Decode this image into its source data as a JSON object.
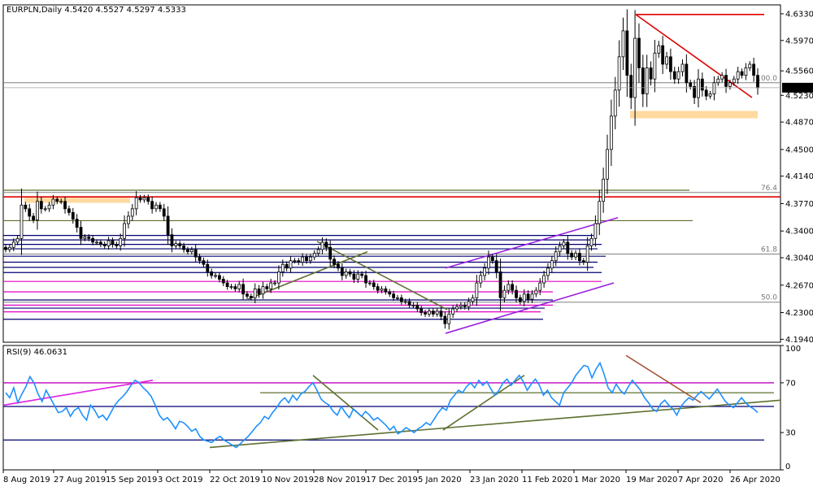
{
  "header": {
    "symbol": "EURPLN,Daily",
    "ohlc": "4.5420 4.5527 4.5297 4.5333"
  },
  "colors": {
    "background": "#ffffff",
    "candle": "#000000",
    "grid": "#808080",
    "red_line": "#e00000",
    "olive_line": "#5e7030",
    "navy_line": "#000070",
    "magenta_line": "#e000c0",
    "purple_line": "#9a20e0",
    "orange_band": "#ffd9a0",
    "rsi_line": "#1e90ff",
    "current_price_bg": "#000000",
    "current_price_fg": "#ffffff"
  },
  "chart_data": [
    {
      "type": "candlestick",
      "title": "EURPLN,Daily",
      "ylim": [
        4.19,
        4.645
      ],
      "y_ticks": [
        "4.6330",
        "4.5970",
        "4.5560",
        "4.5230",
        "4.4870",
        "4.4500",
        "4.4140",
        "4.3770",
        "4.3400",
        "4.3040",
        "4.2670",
        "4.2300",
        "4.1940"
      ],
      "current_price": "4.5333",
      "x_labels": [
        "8 Aug 2019",
        "27 Aug 2019",
        "15 Sep 2019",
        "3 Oct 2019",
        "22 Oct 2019",
        "10 Nov 2019",
        "28 Nov 2019",
        "17 Dec 2019",
        "5 Jan 2020",
        "23 Jan 2020",
        "11 Feb 2020",
        "1 Mar 2020",
        "19 Mar 2020",
        "7 Apr 2020",
        "26 Apr 2020"
      ],
      "fib_levels": [
        {
          "label": "100.0",
          "value": 4.54
        },
        {
          "label": "76.4",
          "value": 4.392
        },
        {
          "label": "61.8",
          "value": 4.309
        },
        {
          "label": "50.0",
          "value": 4.244
        }
      ],
      "closes": [
        4.315,
        4.318,
        4.325,
        4.33,
        4.375,
        4.37,
        4.36,
        4.355,
        4.38,
        4.37,
        4.37,
        4.375,
        4.383,
        4.38,
        4.38,
        4.37,
        4.365,
        4.356,
        4.345,
        4.33,
        4.332,
        4.33,
        4.325,
        4.325,
        4.322,
        4.32,
        4.327,
        4.322,
        4.32,
        4.33,
        4.35,
        4.36,
        4.37,
        4.385,
        4.382,
        4.385,
        4.38,
        4.37,
        4.375,
        4.37,
        4.36,
        4.335,
        4.32,
        4.323,
        4.32,
        4.315,
        4.312,
        4.315,
        4.305,
        4.3,
        4.295,
        4.285,
        4.28,
        4.28,
        4.275,
        4.27,
        4.265,
        4.265,
        4.262,
        4.268,
        4.255,
        4.252,
        4.25,
        4.262,
        4.255,
        4.265,
        4.262,
        4.27,
        4.27,
        4.285,
        4.295,
        4.29,
        4.3,
        4.3,
        4.298,
        4.305,
        4.3,
        4.305,
        4.31,
        4.315,
        4.325,
        4.318,
        4.302,
        4.295,
        4.29,
        4.28,
        4.285,
        4.282,
        4.275,
        4.282,
        4.28,
        4.27,
        4.27,
        4.265,
        4.26,
        4.262,
        4.258,
        4.255,
        4.25,
        4.25,
        4.245,
        4.245,
        4.24,
        4.24,
        4.235,
        4.23,
        4.228,
        4.232,
        4.228,
        4.232,
        4.225,
        4.215,
        4.228,
        4.235,
        4.238,
        4.24,
        4.238,
        4.245,
        4.25,
        4.27,
        4.28,
        4.29,
        4.305,
        4.3,
        4.285,
        4.25,
        4.26,
        4.268,
        4.26,
        4.25,
        4.245,
        4.255,
        4.248,
        4.255,
        4.26,
        4.27,
        4.28,
        4.29,
        4.3,
        4.312,
        4.32,
        4.325,
        4.31,
        4.305,
        4.31,
        4.3,
        4.298,
        4.32,
        4.33,
        4.35,
        4.38,
        4.41,
        4.45,
        4.495,
        4.53,
        4.575,
        4.61,
        4.55,
        4.52,
        4.6,
        4.56,
        4.525,
        4.56,
        4.545,
        4.58,
        4.59,
        4.565,
        4.575,
        4.555,
        4.545,
        4.555,
        4.565,
        4.54,
        4.535,
        4.52,
        4.545,
        4.53,
        4.522,
        4.525,
        4.54,
        4.545,
        4.55,
        4.535,
        4.54,
        4.545,
        4.555,
        4.55,
        4.56,
        4.565,
        4.55,
        4.5333
      ]
    },
    {
      "type": "line",
      "title": "RSI(9) 46.0631",
      "ylim": [
        0,
        100
      ],
      "y_ticks": [
        "100",
        "70",
        "30",
        "0"
      ],
      "levels": [
        70,
        52,
        24
      ],
      "values": [
        62,
        58,
        66,
        54,
        61,
        67,
        75,
        70,
        61,
        55,
        64,
        58,
        52,
        46,
        47,
        50,
        43,
        48,
        50,
        44,
        40,
        52,
        48,
        42,
        44,
        40,
        46,
        52,
        56,
        59,
        63,
        68,
        72,
        70,
        66,
        63,
        59,
        52,
        44,
        40,
        42,
        38,
        33,
        39,
        38,
        35,
        31,
        33,
        27,
        24,
        23,
        22,
        25,
        27,
        24,
        22,
        20,
        18,
        21,
        24,
        27,
        31,
        35,
        38,
        43,
        41,
        46,
        50,
        55,
        58,
        54,
        60,
        56,
        61,
        63,
        67,
        70,
        64,
        57,
        54,
        52,
        47,
        44,
        51,
        46,
        42,
        49,
        46,
        43,
        47,
        44,
        40,
        42,
        39,
        36,
        32,
        35,
        29,
        31,
        34,
        32,
        30,
        33,
        35,
        38,
        36,
        41,
        46,
        50,
        48,
        56,
        60,
        64,
        62,
        67,
        70,
        66,
        72,
        68,
        71,
        65,
        60,
        64,
        70,
        73,
        68,
        72,
        76,
        71,
        64,
        69,
        73,
        68,
        60,
        64,
        58,
        55,
        52,
        62,
        66,
        70,
        76,
        80,
        84,
        83,
        74,
        81,
        86,
        77,
        66,
        62,
        69,
        64,
        61,
        67,
        72,
        68,
        64,
        58,
        54,
        49,
        47,
        53,
        56,
        52,
        49,
        44,
        51,
        55,
        58,
        56,
        60,
        63,
        60,
        57,
        61,
        65,
        60,
        55,
        52,
        50,
        54,
        58,
        54,
        51,
        49,
        46.06
      ]
    }
  ]
}
